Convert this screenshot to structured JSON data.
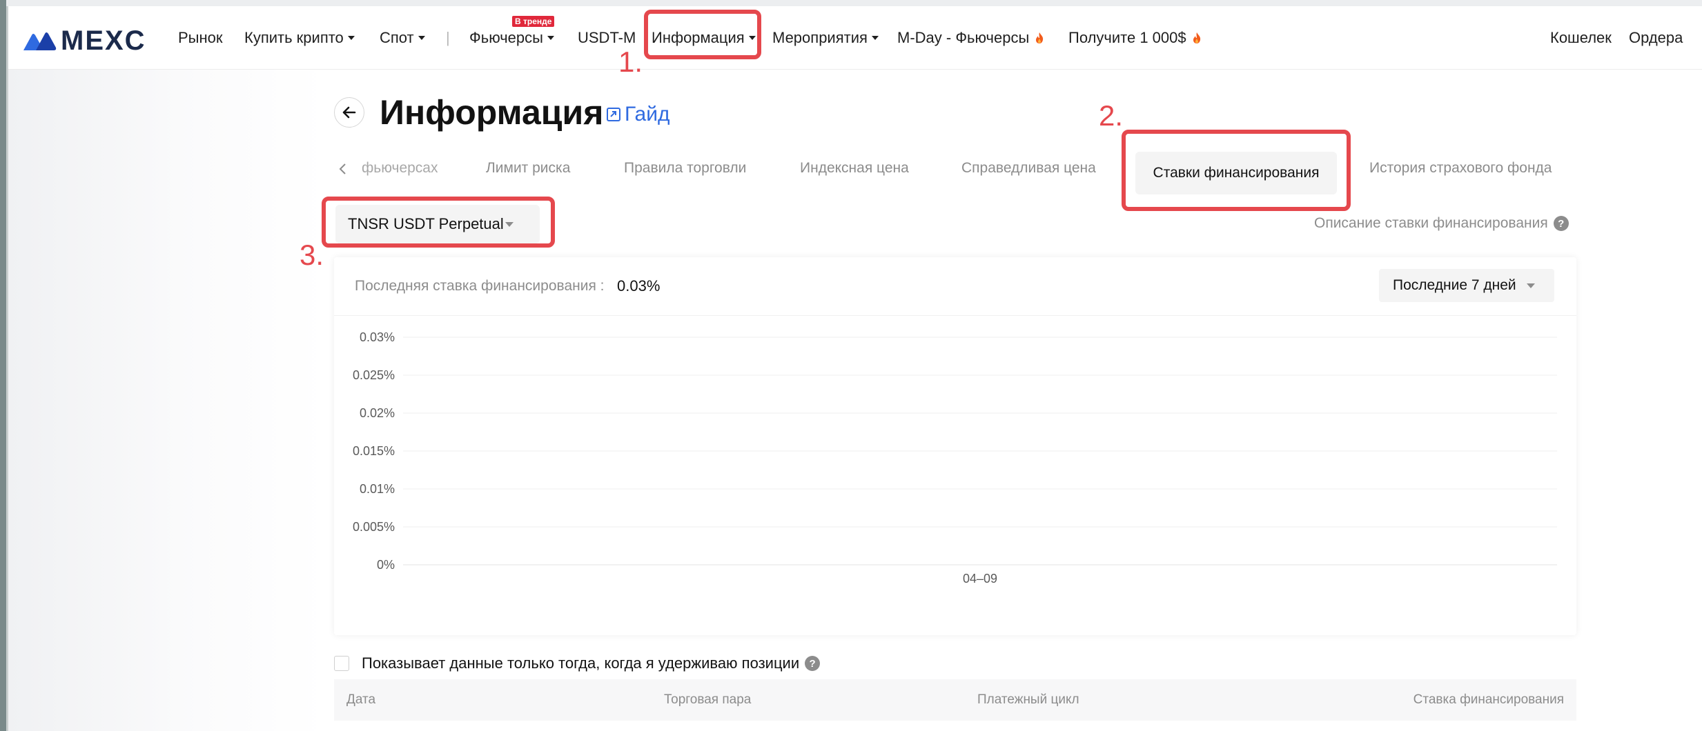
{
  "header": {
    "logo_text": "MEXC",
    "nav": [
      {
        "label": "Рынок",
        "has_caret": false
      },
      {
        "label": "Купить крипто",
        "has_caret": true
      },
      {
        "label": "Спот",
        "has_caret": true
      },
      {
        "label": "|",
        "has_caret": false
      },
      {
        "label": "Фьючерсы",
        "has_caret": true,
        "badge": "В тренде"
      },
      {
        "label": "USDT-M",
        "has_caret": false
      },
      {
        "label": "Информация",
        "has_caret": true
      },
      {
        "label": "Мероприятия",
        "has_caret": true
      },
      {
        "label": "M-Day - Фьючерсы",
        "has_caret": false,
        "icon": "fire-icon"
      },
      {
        "label": "Получите 1 000$",
        "has_caret": false,
        "icon": "fire-icon"
      }
    ],
    "right": {
      "wallet": "Кошелек",
      "orders": "Ордера"
    }
  },
  "annotations": [
    "1.",
    "2.",
    "3."
  ],
  "page": {
    "title": "Информация",
    "guide": "Гайд",
    "tabs": [
      "фьючерсах",
      "Лимит риска",
      "Правила торговли",
      "Индексная цена",
      "Справедливая цена",
      "Ставки финансирования",
      "История страхового фонда"
    ],
    "active_tab": "Ставки финансирования",
    "contract": "TNSR USDT Perpetual",
    "rate_description": "Описание ставки финансирования",
    "last_rate_label": "Последняя ставка финансирования :",
    "last_rate_value": "0.03%",
    "period": "Последние 7 дней",
    "only_holding": "Показывает данные только тогда, когда я удерживаю позиции",
    "table_columns": [
      "Дата",
      "Торговая пара",
      "Платежный цикл",
      "Ставка финансирования"
    ]
  },
  "colors": {
    "accent": "#2f6ae0",
    "annotation": "#e5484d",
    "badge": "#e0283b"
  },
  "chart_data": {
    "type": "line",
    "y_tick_labels": [
      "0.03%",
      "0.025%",
      "0.02%",
      "0.015%",
      "0.01%",
      "0.005%",
      "0%"
    ],
    "x_tick_labels": [
      "04–09"
    ],
    "ylim": [
      0,
      0.03
    ],
    "grid": true,
    "series": []
  }
}
